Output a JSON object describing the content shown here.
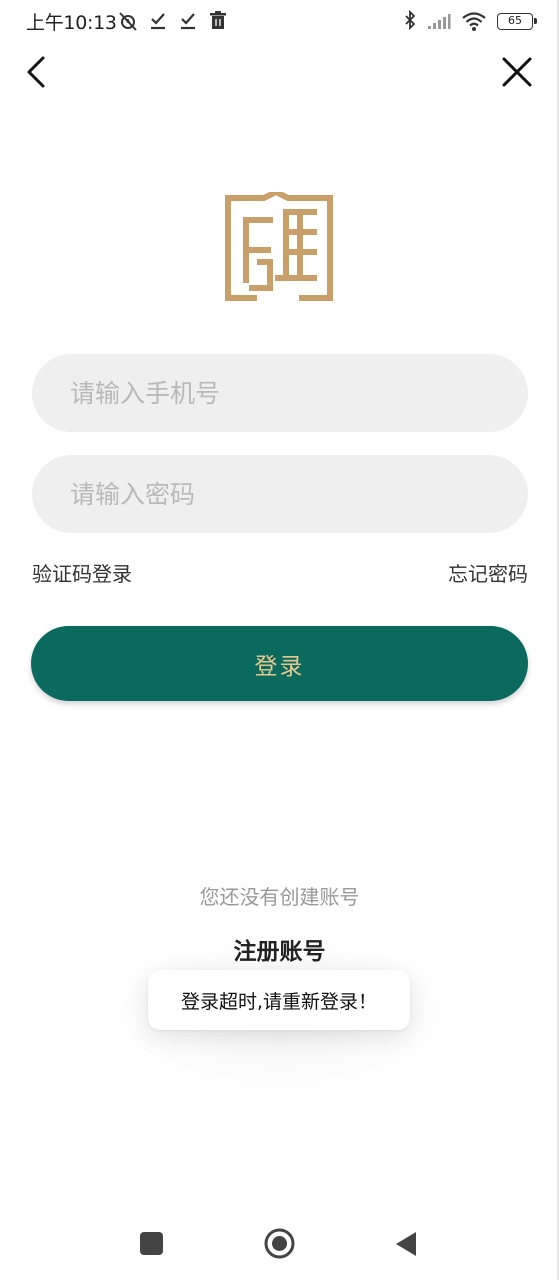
{
  "status_bar": {
    "time": "上午10:13",
    "left_icons": [
      "alarm-off-icon",
      "download-check-icon",
      "download-check-icon",
      "trash-icon"
    ],
    "right_icons": [
      "bluetooth-icon",
      "signal-icon",
      "wifi-icon",
      "battery-icon"
    ],
    "battery": "65"
  },
  "nav": {
    "back_icon": "chevron-left-icon",
    "close_icon": "close-icon"
  },
  "form": {
    "phone_placeholder": "请输入手机号",
    "password_placeholder": "请输入密码",
    "sms_login_label": "验证码登录",
    "forgot_password_label": "忘记密码",
    "login_button_label": "登录"
  },
  "footer": {
    "no_account_text": "您还没有创建账号",
    "register_label": "注册账号"
  },
  "toast": {
    "message": "登录超时,请重新登录！"
  },
  "colors": {
    "primary": "#0b6a5e",
    "button_text": "#e7c88f",
    "logo": "#c9a06a",
    "input_bg": "#efefef"
  }
}
